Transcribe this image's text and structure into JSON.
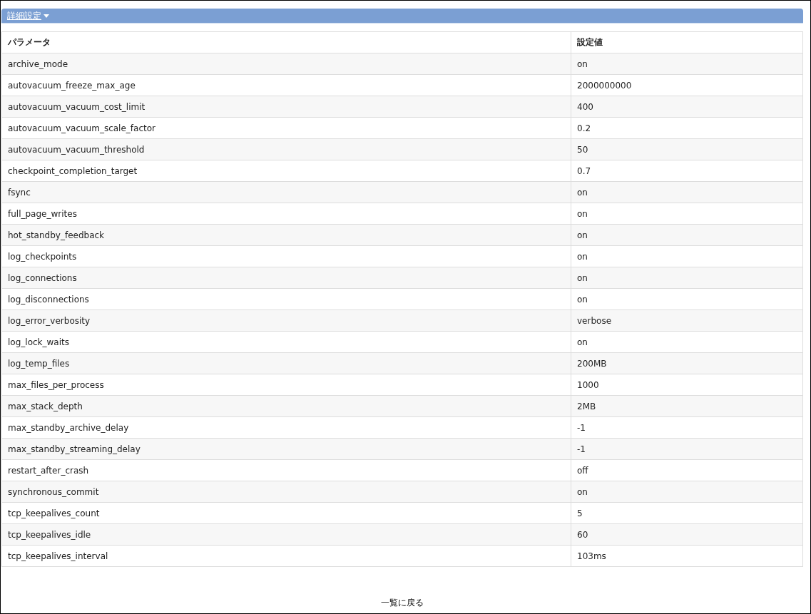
{
  "section": {
    "title": "詳細設定",
    "expanded": true
  },
  "table": {
    "columns": [
      "パラメータ",
      "設定値"
    ],
    "rows": [
      [
        "archive_mode",
        "on"
      ],
      [
        "autovacuum_freeze_max_age",
        "2000000000"
      ],
      [
        "autovacuum_vacuum_cost_limit",
        "400"
      ],
      [
        "autovacuum_vacuum_scale_factor",
        "0.2"
      ],
      [
        "autovacuum_vacuum_threshold",
        "50"
      ],
      [
        "checkpoint_completion_target",
        "0.7"
      ],
      [
        "fsync",
        "on"
      ],
      [
        "full_page_writes",
        "on"
      ],
      [
        "hot_standby_feedback",
        "on"
      ],
      [
        "log_checkpoints",
        "on"
      ],
      [
        "log_connections",
        "on"
      ],
      [
        "log_disconnections",
        "on"
      ],
      [
        "log_error_verbosity",
        "verbose"
      ],
      [
        "log_lock_waits",
        "on"
      ],
      [
        "log_temp_files",
        "200MB"
      ],
      [
        "max_files_per_process",
        "1000"
      ],
      [
        "max_stack_depth",
        "2MB"
      ],
      [
        "max_standby_archive_delay",
        "-1"
      ],
      [
        "max_standby_streaming_delay",
        "-1"
      ],
      [
        "restart_after_crash",
        "off"
      ],
      [
        "synchronous_commit",
        "on"
      ],
      [
        "tcp_keepalives_count",
        "5"
      ],
      [
        "tcp_keepalives_idle",
        "60"
      ],
      [
        "tcp_keepalives_interval",
        "103ms"
      ]
    ]
  },
  "back_link": "一覧に戻る"
}
